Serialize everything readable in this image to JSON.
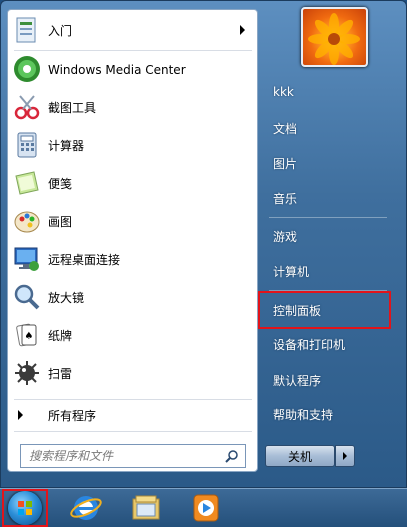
{
  "left_programs": [
    {
      "label": "入门",
      "icon": "getting-started-icon",
      "has_arrow": true
    },
    {
      "label": "Windows Media Center",
      "icon": "media-center-icon",
      "has_arrow": false
    },
    {
      "label": "截图工具",
      "icon": "snipping-tool-icon",
      "has_arrow": false
    },
    {
      "label": "计算器",
      "icon": "calculator-icon",
      "has_arrow": false
    },
    {
      "label": "便笺",
      "icon": "sticky-notes-icon",
      "has_arrow": false
    },
    {
      "label": "画图",
      "icon": "paint-icon",
      "has_arrow": false
    },
    {
      "label": "远程桌面连接",
      "icon": "remote-desktop-icon",
      "has_arrow": false
    },
    {
      "label": "放大镜",
      "icon": "magnifier-icon",
      "has_arrow": false
    },
    {
      "label": "纸牌",
      "icon": "solitaire-icon",
      "has_arrow": false
    },
    {
      "label": "扫雷",
      "icon": "minesweeper-icon",
      "has_arrow": false
    }
  ],
  "all_programs_label": "所有程序",
  "search": {
    "placeholder": "搜索程序和文件"
  },
  "right_items": [
    {
      "label": "kkk"
    },
    {
      "label": "文档"
    },
    {
      "label": "图片"
    },
    {
      "label": "音乐"
    },
    {
      "label": "游戏"
    },
    {
      "label": "计算机"
    },
    {
      "label": "控制面板"
    },
    {
      "label": "设备和打印机"
    },
    {
      "label": "默认程序"
    },
    {
      "label": "帮助和支持"
    }
  ],
  "shutdown_label": "关机",
  "highlight_color": "#e2141a",
  "taskbar_items": [
    "start-orb-icon",
    "internet-explorer-icon",
    "libraries-icon",
    "media-player-icon"
  ]
}
